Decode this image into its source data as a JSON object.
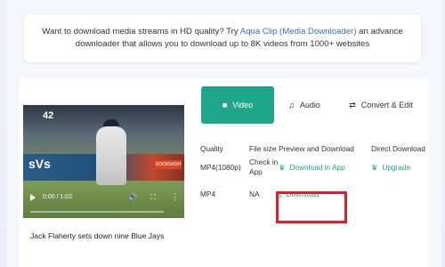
{
  "promo": {
    "text_before": "Want to download media streams in HD quality? Try ",
    "link": "Aqua Clip (Media Downloader)",
    "text_after": " an advance downloader that allows you to download up to 8K videos from 1000+ websites"
  },
  "video": {
    "time": "0:00 / 1:02",
    "caption": "Jack Flaherty sets down nine Blue Jays",
    "overlay_number": "42",
    "overlay_text": "sVs",
    "ad_text": "DOORDASH"
  },
  "tabs": [
    {
      "label": "Video",
      "icon": "video-camera-icon",
      "active": true
    },
    {
      "label": "Audio",
      "icon": "music-note-icon"
    },
    {
      "label": "Convert & Edit",
      "icon": "convert-icon"
    }
  ],
  "table": {
    "headers": [
      "Quality",
      "File size",
      "Preview and Download",
      "Direct Download"
    ],
    "rows": [
      {
        "quality": "MP4(1080p)",
        "size": "Check in App",
        "preview": "Download in App",
        "direct": "Upgrade"
      },
      {
        "quality": "MP4",
        "size": "NA",
        "preview": "Download",
        "direct": ""
      }
    ]
  },
  "colors": {
    "accent": "#1fa68a",
    "link": "#2f6fd6",
    "highlight": "#e01e2b"
  }
}
